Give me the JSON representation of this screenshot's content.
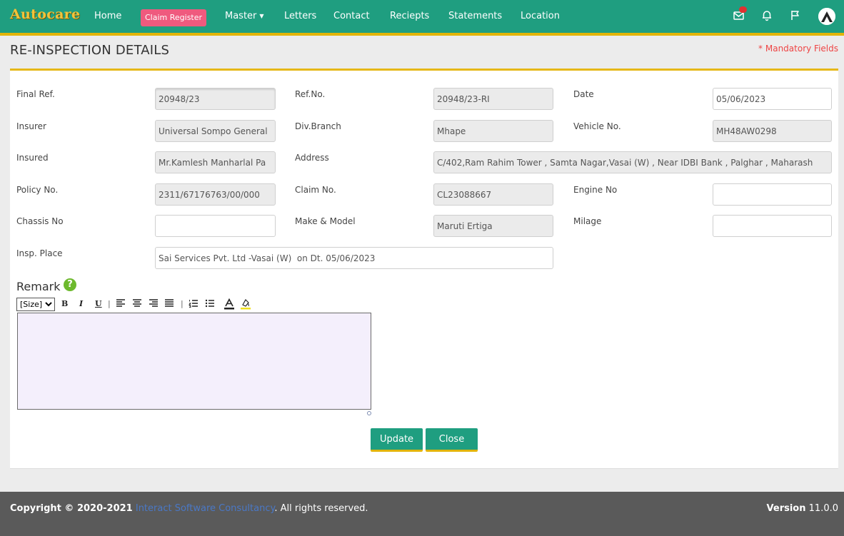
{
  "nav": {
    "brand": "Autocare",
    "items": [
      "Home",
      "Claim Register",
      "Master",
      "Letters",
      "Contact",
      "Reciepts",
      "Statements",
      "Location"
    ]
  },
  "header": {
    "title": "RE-INSPECTION DETAILS",
    "mandatory_note": "* Mandatory Fields"
  },
  "form": {
    "final_ref": {
      "label": "Final Ref.",
      "value": "20948/23"
    },
    "ref_no": {
      "label": "Ref.No.",
      "value": "20948/23-RI"
    },
    "date": {
      "label": "Date",
      "value": "05/06/2023"
    },
    "insurer": {
      "label": "Insurer",
      "value": "Universal Sompo General"
    },
    "div_branch": {
      "label": "Div.Branch",
      "value": "Mhape"
    },
    "vehicle_no": {
      "label": "Vehicle No.",
      "value": "MH48AW0298"
    },
    "insured": {
      "label": "Insured",
      "value": "Mr.Kamlesh Manharlal Pa"
    },
    "address": {
      "label": "Address",
      "value": "C/402,Ram Rahim Tower , Samta Nagar,Vasai (W) , Near IDBI Bank , Palghar , Maharash"
    },
    "policy_no": {
      "label": "Policy No.",
      "value": "2311/67176763/00/000"
    },
    "claim_no": {
      "label": "Claim No.",
      "value": "CL23088667"
    },
    "engine_no": {
      "label": "Engine No",
      "value": ""
    },
    "chassis_no": {
      "label": "Chassis No",
      "value": ""
    },
    "make_model": {
      "label": "Make & Model",
      "value": "Maruti Ertiga"
    },
    "milage": {
      "label": "Milage",
      "value": ""
    },
    "insp_place": {
      "label": "Insp. Place",
      "value": "Sai Services Pvt. Ltd -Vasai (W)  on Dt. 05/06/2023"
    }
  },
  "remark": {
    "label": "Remark",
    "help": "?",
    "size_option": "[Size]",
    "toolbar": {
      "bold": "B",
      "italic": "I",
      "underline": "U",
      "sep": "|"
    },
    "text": ""
  },
  "actions": {
    "update": "Update",
    "close": "Close"
  },
  "footer": {
    "copyright_prefix": "Copyright © 2020-2021",
    "company": "Interact Software Consultancy",
    "rights": ". All rights reserved.",
    "version_label": "Version",
    "version": "11.0.0"
  },
  "colors": {
    "primary": "#1f9e80",
    "accent": "#e2b407",
    "pill": "#ef5a7e",
    "mandatory": "#e44444"
  }
}
